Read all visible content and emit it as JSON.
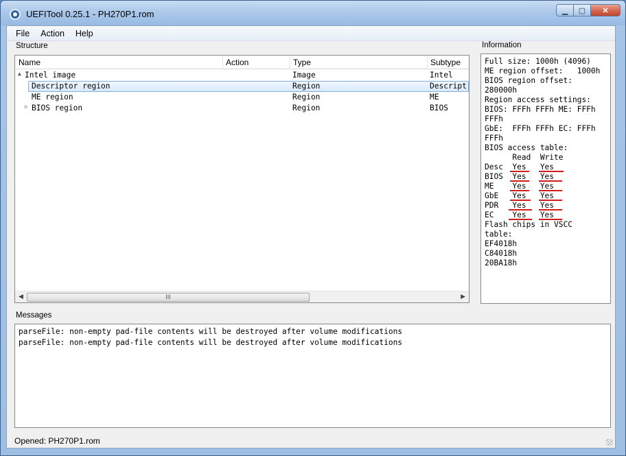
{
  "window": {
    "title": "UEFITool 0.25.1 - PH270P1.rom"
  },
  "menu": {
    "items": [
      "File",
      "Action",
      "Help"
    ]
  },
  "structure": {
    "label": "Structure",
    "columns": [
      "Name",
      "Action",
      "Type",
      "Subtype"
    ],
    "rows": [
      {
        "name": "Intel image",
        "action": "",
        "type": "Image",
        "subtype": "Intel",
        "expander": "▲"
      },
      {
        "name": "Descriptor region",
        "action": "",
        "type": "Region",
        "subtype": "Descript",
        "expander": ""
      },
      {
        "name": "ME region",
        "action": "",
        "type": "Region",
        "subtype": "ME",
        "expander": ""
      },
      {
        "name": "BIOS region",
        "action": "",
        "type": "Region",
        "subtype": "BIOS",
        "expander": "▷"
      }
    ],
    "scrollbar_grip": "III"
  },
  "information": {
    "label": "Information",
    "lines": [
      "Full size: 1000h (4096)",
      "ME region offset:   1000h",
      "BIOS region offset:",
      "280000h",
      "Region access settings:",
      "BIOS: FFFh FFFh ME: FFFh",
      "FFFh",
      "GbE:  FFFh FFFh EC: FFFh",
      "FFFh",
      "BIOS access table:",
      "      Read  Write",
      "Desc  Yes   Yes",
      "BIOS  Yes   Yes",
      "ME    Yes   Yes",
      "GbE   Yes   Yes",
      "PDR   Yes   Yes",
      "EC    Yes   Yes",
      "Flash chips in VSCC",
      "table:",
      "EF4018h",
      "C84018h",
      "20BA18h"
    ]
  },
  "messages": {
    "label": "Messages",
    "lines": [
      "parseFile: non-empty pad-file contents will be destroyed after volume modifications",
      "parseFile: non-empty pad-file contents will be destroyed after volume modifications"
    ]
  },
  "status": {
    "text": "Opened: PH270P1.rom"
  },
  "colors": {
    "annotation": "#d11a1a",
    "selection": "#d9eafc"
  }
}
